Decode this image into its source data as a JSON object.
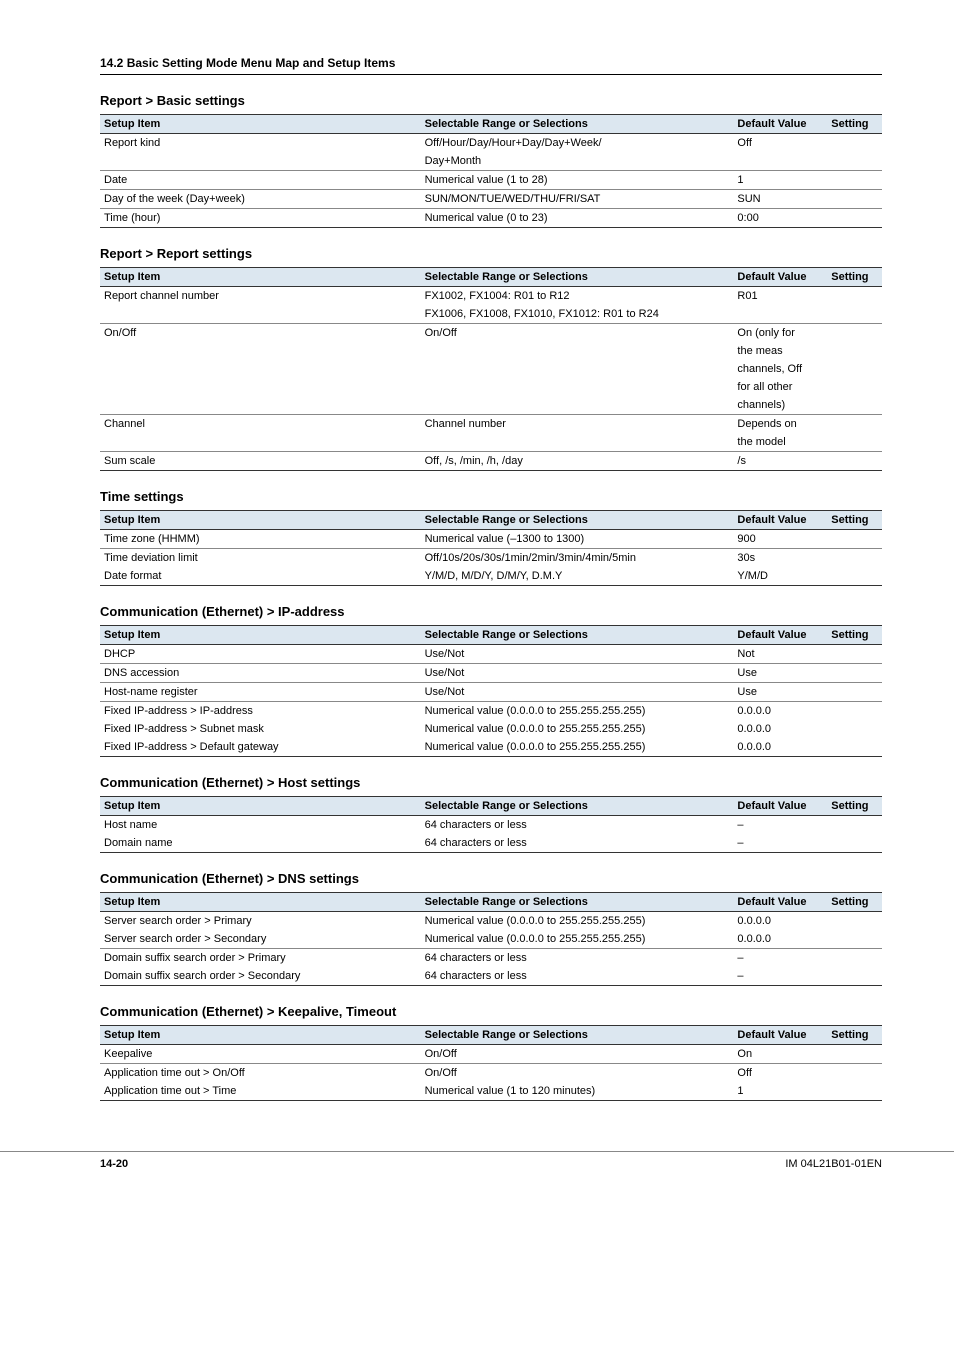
{
  "header": "14.2  Basic Setting Mode Menu Map and Setup Items",
  "columns": {
    "item": "Setup Item",
    "sel": "Selectable Range or Selections",
    "def": "Default Value",
    "set": "Setting"
  },
  "sections": [
    {
      "title": "Report > Basic settings",
      "rows": [
        {
          "cells": [
            "Report kind",
            "Off/Hour/Day/Hour+Day/Day+Week/",
            "Off",
            ""
          ],
          "noborder": true
        },
        {
          "cells": [
            "",
            "Day+Month",
            "",
            ""
          ]
        },
        {
          "cells": [
            "Date",
            "Numerical value (1 to 28)",
            "1",
            ""
          ]
        },
        {
          "cells": [
            "Day of the week (Day+week)",
            "SUN/MON/TUE/WED/THU/FRI/SAT",
            "SUN",
            ""
          ]
        },
        {
          "cells": [
            "Time (hour)",
            "Numerical value (0 to 23)",
            "0:00",
            ""
          ],
          "last": true
        }
      ]
    },
    {
      "title": "Report > Report settings",
      "rows": [
        {
          "cells": [
            "Report channel number",
            "FX1002, FX1004: R01 to R12",
            "R01",
            ""
          ],
          "noborder": true
        },
        {
          "cells": [
            "",
            "FX1006, FX1008, FX1010,  FX1012: R01 to R24",
            "",
            ""
          ]
        },
        {
          "cells": [
            "On/Off",
            "On/Off",
            "On (only for",
            ""
          ],
          "noborder": true
        },
        {
          "cells": [
            "",
            "",
            "the meas",
            ""
          ],
          "noborder": true
        },
        {
          "cells": [
            "",
            "",
            "channels, Off",
            ""
          ],
          "noborder": true
        },
        {
          "cells": [
            "",
            "",
            "for all other",
            ""
          ],
          "noborder": true
        },
        {
          "cells": [
            "",
            "",
            "channels)",
            ""
          ]
        },
        {
          "cells": [
            "Channel",
            "Channel number",
            "Depends on",
            ""
          ],
          "noborder": true
        },
        {
          "cells": [
            "",
            "",
            "the model",
            ""
          ]
        },
        {
          "cells": [
            "Sum scale",
            "Off, /s, /min, /h, /day",
            "/s",
            ""
          ],
          "last": true
        }
      ]
    },
    {
      "title": "Time settings",
      "rows": [
        {
          "cells": [
            "Time zone (HHMM)",
            "Numerical value (–1300 to 1300)",
            "900",
            ""
          ]
        },
        {
          "cells": [
            "Time deviation limit",
            "Off/10s/20s/30s/1min/2min/3min/4min/5min",
            "30s",
            ""
          ],
          "noborder": true
        },
        {
          "cells": [
            "Date format",
            "Y/M/D, M/D/Y, D/M/Y, D.M.Y",
            "Y/M/D",
            ""
          ],
          "last": true
        }
      ]
    },
    {
      "title": "Communication (Ethernet) > IP-address",
      "rows": [
        {
          "cells": [
            "DHCP",
            "Use/Not",
            "Not",
            ""
          ]
        },
        {
          "cells": [
            "DNS accession",
            "Use/Not",
            "Use",
            ""
          ]
        },
        {
          "cells": [
            "Host-name register",
            "Use/Not",
            "Use",
            ""
          ]
        },
        {
          "cells": [
            "Fixed IP-address > IP-address",
            "Numerical value (0.0.0.0 to 255.255.255.255)",
            "0.0.0.0",
            ""
          ],
          "noborder": true
        },
        {
          "cells": [
            "Fixed IP-address > Subnet mask",
            "Numerical value (0.0.0.0 to 255.255.255.255)",
            "0.0.0.0",
            ""
          ],
          "noborder": true
        },
        {
          "cells": [
            "Fixed IP-address > Default gateway",
            "Numerical value (0.0.0.0 to 255.255.255.255)",
            "0.0.0.0",
            ""
          ],
          "last": true
        }
      ]
    },
    {
      "title": "Communication (Ethernet) > Host settings",
      "rows": [
        {
          "cells": [
            "Host name",
            "64 characters or less",
            "–",
            ""
          ],
          "noborder": true
        },
        {
          "cells": [
            "Domain name",
            "64 characters or less",
            "–",
            ""
          ],
          "last": true
        }
      ]
    },
    {
      "title": "Communication (Ethernet) > DNS settings",
      "rows": [
        {
          "cells": [
            "Server search order > Primary",
            "Numerical value (0.0.0.0 to 255.255.255.255)",
            "0.0.0.0",
            ""
          ],
          "noborder": true
        },
        {
          "cells": [
            "Server search order > Secondary",
            "Numerical value (0.0.0.0 to 255.255.255.255)",
            "0.0.0.0",
            ""
          ]
        },
        {
          "cells": [
            "Domain suffix search order > Primary",
            "64 characters or less",
            "–",
            ""
          ],
          "noborder": true
        },
        {
          "cells": [
            "Domain suffix search order > Secondary",
            "64 characters or less",
            "–",
            ""
          ],
          "last": true
        }
      ]
    },
    {
      "title": "Communication (Ethernet) > Keepalive, Timeout",
      "rows": [
        {
          "cells": [
            "Keepalive",
            "On/Off",
            "On",
            ""
          ]
        },
        {
          "cells": [
            "Application time out > On/Off",
            "On/Off",
            "Off",
            ""
          ],
          "noborder": true
        },
        {
          "cells": [
            "Application time out > Time",
            "Numerical value (1 to 120 minutes)",
            "1",
            ""
          ],
          "last": true
        }
      ]
    }
  ],
  "footer": {
    "page": "14-20",
    "doc": "IM 04L21B01-01EN"
  }
}
